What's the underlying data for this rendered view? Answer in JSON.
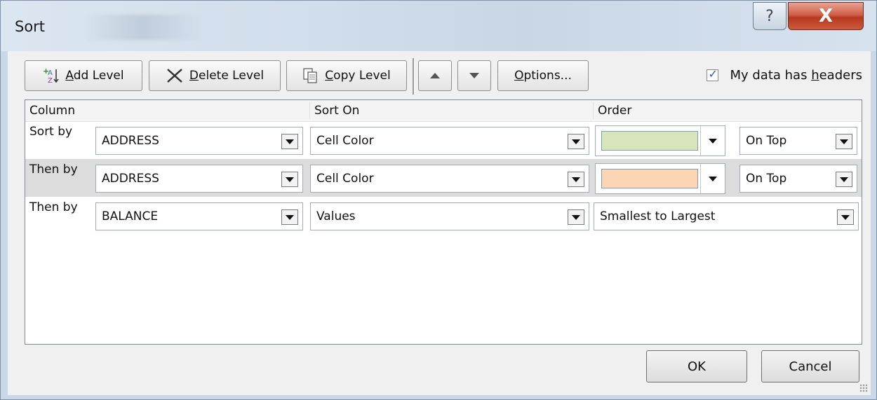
{
  "window": {
    "title": "Sort",
    "help_glyph": "?",
    "close_glyph": "X"
  },
  "toolbar": {
    "add_level": {
      "prefix": "",
      "accel": "A",
      "rest": "dd Level",
      "icon": "sort-az-add-icon"
    },
    "delete_level": {
      "accel": "D",
      "rest": "elete Level",
      "icon": "x-delete-icon"
    },
    "copy_level": {
      "accel": "C",
      "rest": "opy Level",
      "icon": "copy-pages-icon"
    },
    "move_up": {
      "icon": "arrow-up-icon"
    },
    "move_down": {
      "icon": "arrow-down-icon"
    },
    "options": {
      "accel": "O",
      "rest": "ptions..."
    },
    "headers_checkbox": {
      "before": "My data has ",
      "accel": "h",
      "after": "eaders",
      "checked": true
    }
  },
  "grid": {
    "columns": [
      "Column",
      "Sort On",
      "Order"
    ],
    "rows": [
      {
        "label": "Sort by",
        "column": "ADDRESS",
        "sort_on": "Cell Color",
        "order_color": "#d7e4bc",
        "position": "On Top"
      },
      {
        "label": "Then by",
        "column": "ADDRESS",
        "sort_on": "Cell Color",
        "order_color": "#fcd5b4",
        "position": "On Top"
      },
      {
        "label": "Then by",
        "column": "BALANCE",
        "sort_on": "Values",
        "order": "Smallest to Largest"
      }
    ]
  },
  "buttons": {
    "ok": "OK",
    "cancel": "Cancel"
  }
}
